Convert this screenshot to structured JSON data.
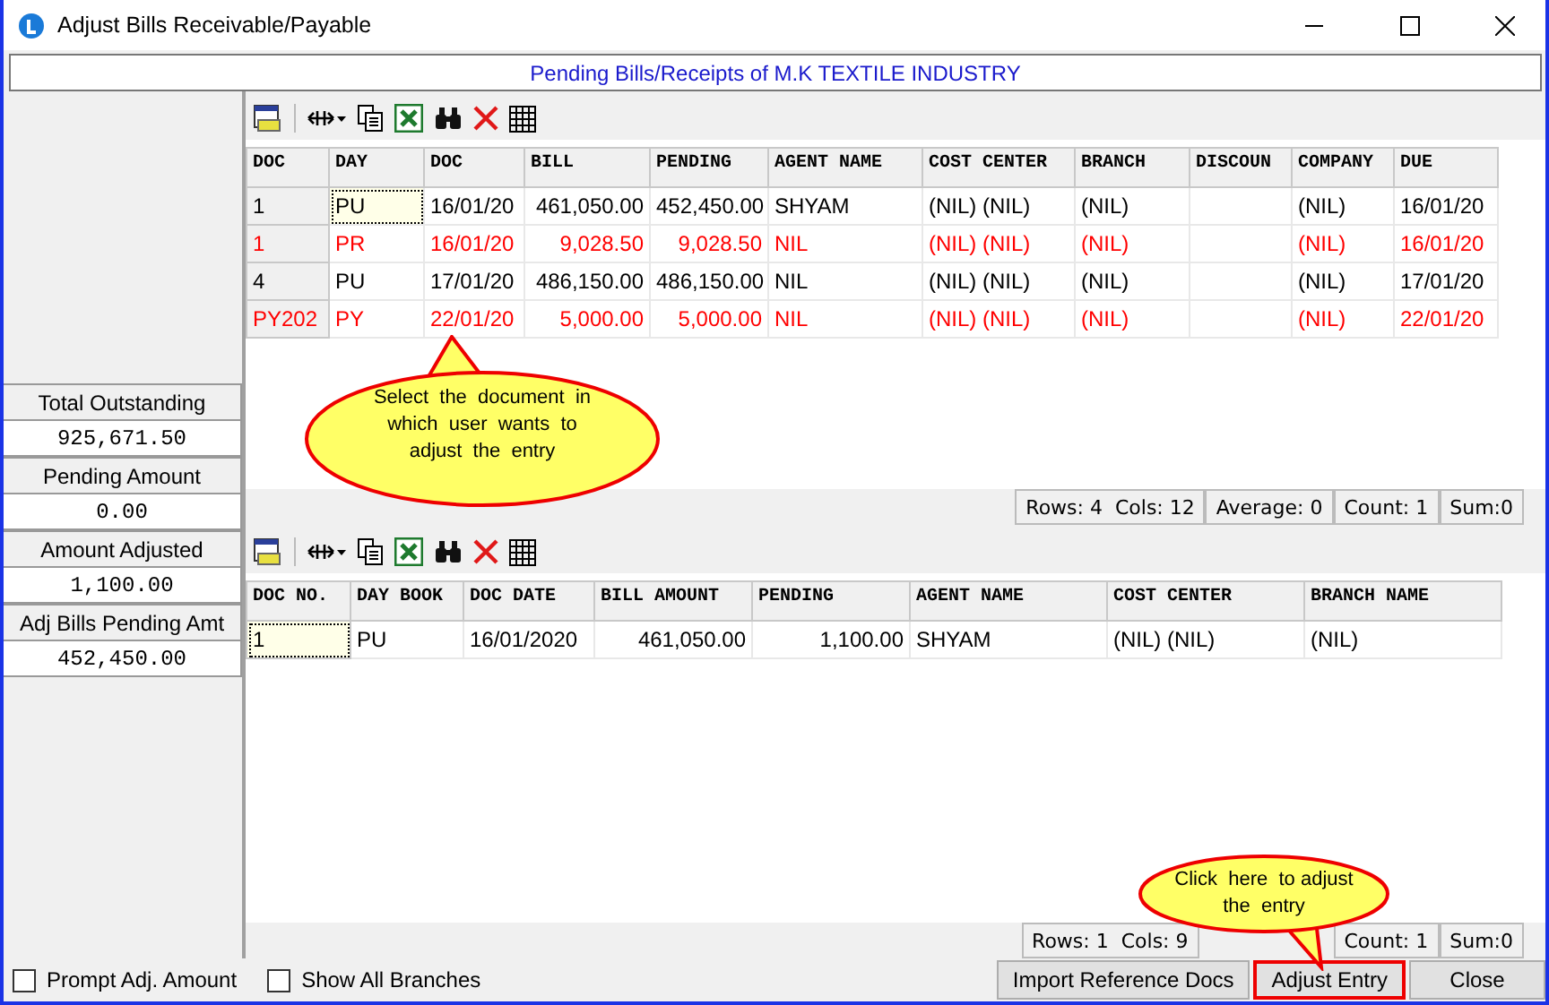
{
  "window": {
    "title": "Adjust Bills Receivable/Payable"
  },
  "header": "Pending Bills/Receipts of M.K TEXTILE INDUSTRY",
  "summary": [
    {
      "label": "Total Outstanding",
      "value": "925,671.50"
    },
    {
      "label": "Pending Amount",
      "value": "0.00"
    },
    {
      "label": "Amount Adjusted",
      "value": "1,100.00"
    },
    {
      "label": "Adj Bills Pending Amt",
      "value": "452,450.00"
    }
  ],
  "pending_table": {
    "columns": [
      "DOC",
      "DAY",
      "DOC",
      "BILL",
      "PENDING",
      "AGENT NAME",
      "COST CENTER",
      "BRANCH",
      "DISCOUN",
      "COMPANY",
      "DUE"
    ],
    "rows": [
      {
        "selected": true,
        "color": "#000000",
        "cells": [
          "1",
          "PU",
          "16/01/20",
          "461,050.00",
          "452,450.00",
          "SHYAM",
          "(NIL) (NIL)",
          "(NIL)",
          "",
          "(NIL)",
          "16/01/20"
        ]
      },
      {
        "selected": false,
        "color": "#ff0000",
        "cells": [
          "1",
          "PR",
          "16/01/20",
          "9,028.50",
          "9,028.50",
          "NIL",
          "(NIL) (NIL)",
          "(NIL)",
          "",
          "(NIL)",
          "16/01/20"
        ]
      },
      {
        "selected": false,
        "color": "#000000",
        "cells": [
          "4",
          "PU",
          "17/01/20",
          "486,150.00",
          "486,150.00",
          "NIL",
          "(NIL) (NIL)",
          "(NIL)",
          "",
          "(NIL)",
          "17/01/20"
        ]
      },
      {
        "selected": false,
        "color": "#ff0000",
        "cells": [
          "PY202",
          "PY",
          "22/01/20",
          "5,000.00",
          "5,000.00",
          "NIL",
          "(NIL) (NIL)",
          "(NIL)",
          "",
          "(NIL)",
          "22/01/20"
        ]
      }
    ],
    "status": [
      "Rows: 4  Cols: 12",
      "Average: 0",
      "Count: 1",
      "Sum:0"
    ]
  },
  "adjusted_table": {
    "columns": [
      "DOC NO.",
      "DAY BOOK",
      "DOC DATE",
      "BILL AMOUNT",
      "PENDING",
      "AGENT NAME",
      "COST CENTER",
      "BRANCH NAME"
    ],
    "rows": [
      {
        "selected": true,
        "color": "#000000",
        "cells": [
          "1",
          "PU",
          "16/01/2020",
          "461,050.00",
          "1,100.00",
          "SHYAM",
          "(NIL) (NIL)",
          "(NIL)"
        ]
      }
    ],
    "status": [
      "Rows: 1  Cols: 9",
      "Count: 1",
      "Sum:0"
    ]
  },
  "callouts": [
    {
      "kind": "select",
      "text": "Select  the  document  in which  user  wants  to adjust  the  entry"
    },
    {
      "kind": "adjust",
      "text": "Click  here  to adjust  the  entry"
    }
  ],
  "options": [
    {
      "label": "Prompt Adj. Amount",
      "checked": false
    },
    {
      "label": "Show All Branches",
      "checked": false
    }
  ],
  "buttons": [
    {
      "label": "Import Reference Docs",
      "highlighted": false
    },
    {
      "label": "Adjust Entry",
      "highlighted": true
    },
    {
      "label": "Close",
      "highlighted": false
    }
  ]
}
